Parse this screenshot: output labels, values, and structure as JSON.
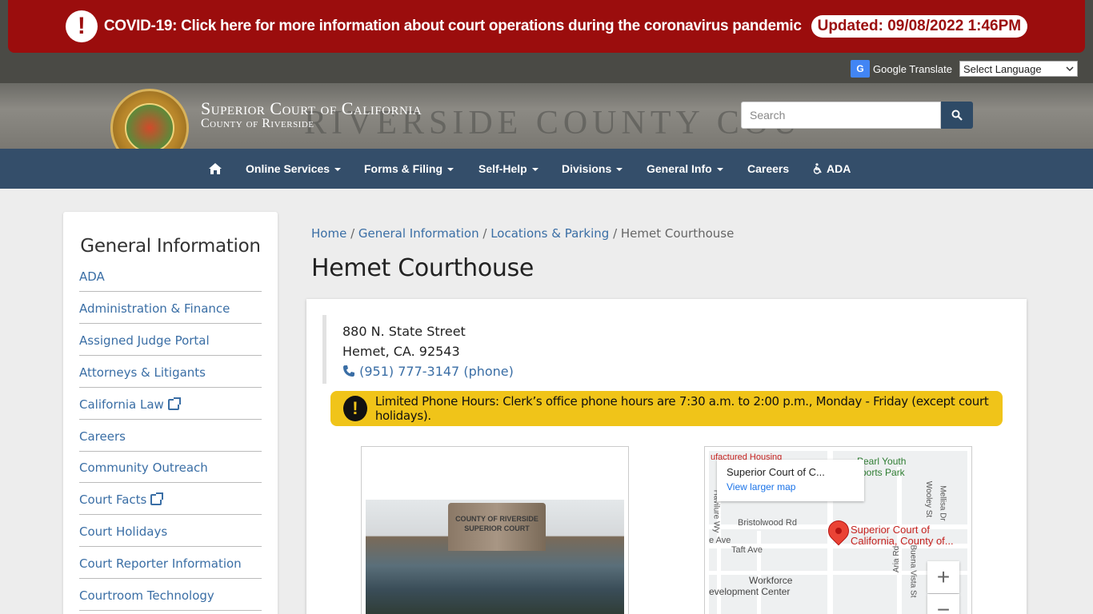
{
  "covid_banner": {
    "text": "COVID-19: Click here for more information about court operations during the coronavirus pandemic",
    "updated": "Updated: 09/08/2022 1:46PM"
  },
  "translate": {
    "label": "Google Translate",
    "select_value": "Select Language"
  },
  "header": {
    "title": "Superior Court of California",
    "subtitle": "County of Riverside",
    "watermark": "RIVERSIDE COUNTY COU",
    "search_placeholder": "Search"
  },
  "nav": {
    "items": [
      {
        "label": "Online Services"
      },
      {
        "label": "Forms & Filing"
      },
      {
        "label": "Self-Help"
      },
      {
        "label": "Divisions"
      },
      {
        "label": "General Info"
      },
      {
        "label": "Careers"
      },
      {
        "label": "ADA"
      }
    ]
  },
  "sidebar": {
    "title": "General Information",
    "items": [
      {
        "label": "ADA"
      },
      {
        "label": "Administration & Finance"
      },
      {
        "label": "Assigned Judge Portal"
      },
      {
        "label": "Attorneys & Litigants"
      },
      {
        "label": "California Law"
      },
      {
        "label": "Careers"
      },
      {
        "label": "Community Outreach"
      },
      {
        "label": "Court Facts"
      },
      {
        "label": "Court Holidays"
      },
      {
        "label": "Court Reporter Information"
      },
      {
        "label": "Courtroom Technology"
      }
    ]
  },
  "breadcrumb": {
    "home": "Home",
    "general": "General Information",
    "locations": "Locations & Parking",
    "current": "Hemet Courthouse"
  },
  "page": {
    "title": "Hemet Courthouse",
    "address_line1": "880 N. State Street",
    "address_line2": "Hemet, CA. 92543",
    "phone": "(951) 777-3147 (phone)",
    "alert": "Limited Phone Hours: Clerk’s office phone hours are 7:30 a.m. to 2:00 p.m., Monday - Friday (except court holidays).",
    "photo_sign": "COUNTY OF RIVERSIDE SUPERIOR COURT"
  },
  "map": {
    "card_title": "Superior Court of C...",
    "card_link": "View larger map",
    "pin_label_1": "Superior Court of",
    "pin_label_2": "California, County of...",
    "labels": {
      "bristolwood": "Bristolwood Rd",
      "taft": "Taft Ave",
      "workforce1": "Workforce",
      "workforce2": "evelopment Center",
      "pearl1": "Pearl Youth",
      "pearl2": "ports Park",
      "manufactured": "ufactured Housing",
      "ave": "e Ave",
      "havilure": "Havilure Wy",
      "wooley": "Wooley St",
      "mellisa": "Mellisa Dr",
      "aria": "Aria Rd",
      "buena": "Buena Vista St"
    },
    "zoom_in": "+",
    "zoom_out": "−"
  },
  "colors": {
    "covid_red": "#9b0d0d",
    "nav_blue": "#344e6a",
    "link_blue": "#3a6ea5",
    "alert_yellow": "#f0c419"
  }
}
